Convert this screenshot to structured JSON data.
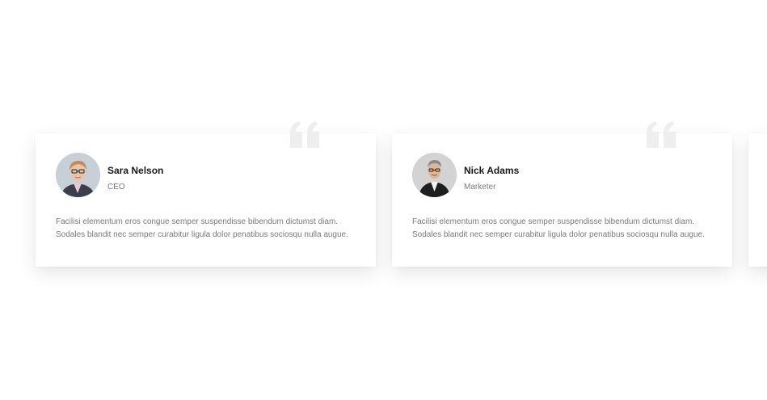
{
  "testimonials": [
    {
      "name": "Sara Nelson",
      "role": "CEO",
      "text": "Facilisi elementum eros congue semper suspendisse bibendum dictumst diam. Sodales blandit nec semper curabitur ligula dolor penatibus sociosqu nulla augue.",
      "avatar": "sara-nelson-avatar"
    },
    {
      "name": "Nick Adams",
      "role": "Marketer",
      "text": "Facilisi elementum eros congue semper suspendisse bibendum dictumst diam. Sodales blandit nec semper curabitur ligula dolor penatibus sociosqu nulla augue.",
      "avatar": "nick-adams-avatar"
    }
  ],
  "icons": {
    "quote": "quote-icon"
  },
  "colors": {
    "quote_mark": "#eeeeee",
    "name": "#1a1a1a",
    "muted": "#7a7a7a"
  }
}
